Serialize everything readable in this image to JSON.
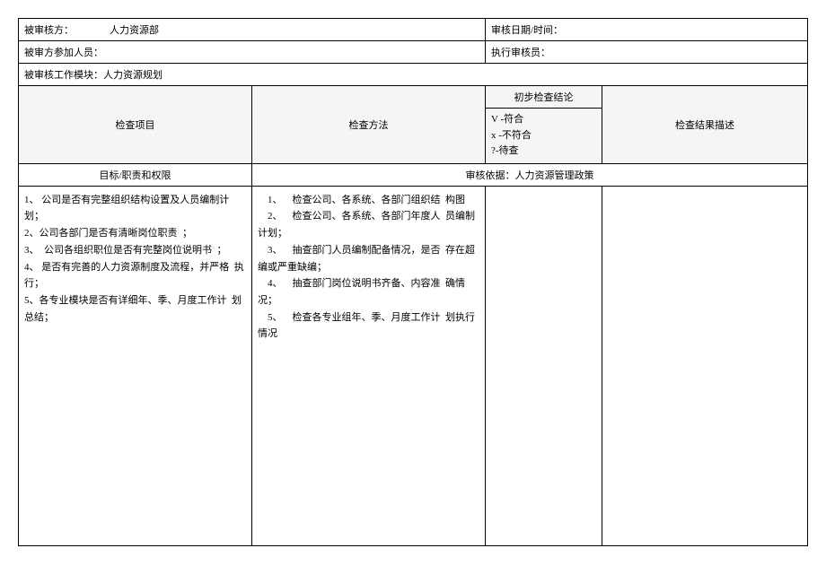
{
  "header": {
    "auditee_label": "被审核方：",
    "auditee_value": "人力资源部",
    "date_label": "审核日期/时间：",
    "date_value": "",
    "participants_label": "被审方参加人员：",
    "participants_value": "",
    "auditor_label": "执行审核员：",
    "auditor_value": "",
    "module_label": "被审核工作模块：人力资源规划"
  },
  "columns": {
    "item": "检查项目",
    "method": "检查方法",
    "prelim_title": "初步检查结论",
    "legend_v": "V  -符合",
    "legend_x": "x    -不符合",
    "legend_q": "?-待查",
    "result": "检查结果描述"
  },
  "subheader": {
    "left": "目标/职责和权限",
    "right": "审核依据：人力资源管理政策"
  },
  "content": {
    "items": "1、 公司是否有完整组织结构设置及人员编制计  划；\n2、公司各部门是否有清晰岗位职责  ；\n3、  公司各组织职位是否有完整岗位说明书  ；\n4、 是否有完善的人力资源制度及流程，并严格  执行；\n5、各专业模块是否有详细年、季、月度工作计  划总结；",
    "methods": "    1、    检查公司、各系统、各部门组织结  构图\n    2、    检查公司、各系统、各部门年度人  员编制计划；\n    3、    抽查部门人员编制配备情况，是否  存在超编或严重缺编；\n    4、    抽查部门岗位说明书齐备、内容准  确情况；\n    5、    检查各专业组年、季、月度工作计  划执行情况",
    "prelim": "",
    "result": ""
  }
}
